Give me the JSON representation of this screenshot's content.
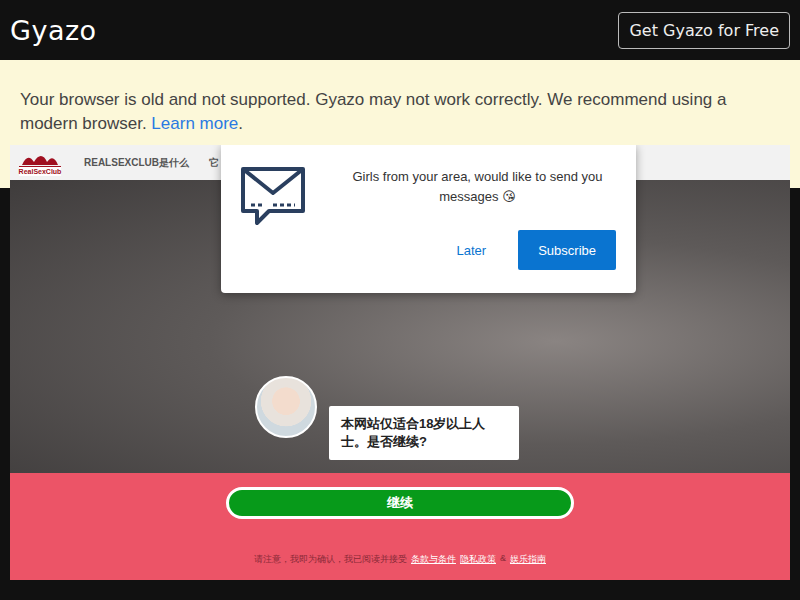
{
  "app": {
    "logo": "Gyazo",
    "cta": "Get Gyazo for Free"
  },
  "banner": {
    "text": "Your browser is old and not supported. Gyazo may not work correctly. We recommend using a modern browser.",
    "link": "Learn more",
    "suffix": "."
  },
  "site": {
    "logo": "RealSexClub",
    "nav": [
      {
        "label": "REALSEXCLUB是什么"
      },
      {
        "label": "它"
      }
    ],
    "chat": {
      "message": "本网站仅适合18岁以上人士。是否继续?"
    },
    "continue": "继续",
    "legal": {
      "text": "请注意，我即为确认，我已阅读并接受",
      "links": [
        "条款与条件",
        "隐私政策",
        "娱乐指南"
      ],
      "amp": "&"
    }
  },
  "notification": {
    "message": "Girls from your area, would like to send you messages 😘",
    "buttons": [
      {
        "label": "Later",
        "primary": false
      },
      {
        "label": "Subscribe",
        "primary": true
      }
    ]
  }
}
